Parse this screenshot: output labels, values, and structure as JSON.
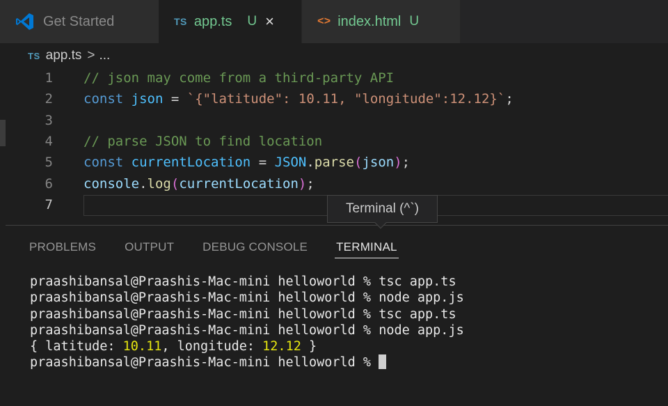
{
  "tabs": [
    {
      "label": "Get Started",
      "icon": "vscode-logo-icon",
      "active": false
    },
    {
      "label": "app.ts",
      "badge": "TS",
      "status": "U",
      "active": true
    },
    {
      "label": "index.html",
      "badge": "<>",
      "status": "U",
      "active": false
    }
  ],
  "breadcrumb": {
    "badge": "TS",
    "file": "app.ts",
    "chevron": ">",
    "more": "..."
  },
  "editor": {
    "lines": [
      {
        "num": "1",
        "tokens": [
          {
            "t": "// json may come from a third-party API",
            "c": "comment"
          }
        ]
      },
      {
        "num": "2",
        "tokens": [
          {
            "t": "const",
            "c": "kw"
          },
          {
            "t": " ",
            "c": "plain"
          },
          {
            "t": "json",
            "c": "var"
          },
          {
            "t": " = ",
            "c": "plain"
          },
          {
            "t": "`{\"latitude\": 10.11, \"longitude\":12.12}`",
            "c": "str"
          },
          {
            "t": ";",
            "c": "plain"
          }
        ]
      },
      {
        "num": "3",
        "tokens": []
      },
      {
        "num": "4",
        "tokens": [
          {
            "t": "// parse JSON to find location",
            "c": "comment"
          }
        ]
      },
      {
        "num": "5",
        "tokens": [
          {
            "t": "const",
            "c": "kw"
          },
          {
            "t": " ",
            "c": "plain"
          },
          {
            "t": "currentLocation",
            "c": "var"
          },
          {
            "t": " = ",
            "c": "plain"
          },
          {
            "t": "JSON",
            "c": "const"
          },
          {
            "t": ".",
            "c": "plain"
          },
          {
            "t": "parse",
            "c": "fn"
          },
          {
            "t": "(",
            "c": "brace"
          },
          {
            "t": "json",
            "c": "prop"
          },
          {
            "t": ")",
            "c": "brace"
          },
          {
            "t": ";",
            "c": "plain"
          }
        ]
      },
      {
        "num": "6",
        "tokens": [
          {
            "t": "console",
            "c": "prop"
          },
          {
            "t": ".",
            "c": "plain"
          },
          {
            "t": "log",
            "c": "fn"
          },
          {
            "t": "(",
            "c": "brace"
          },
          {
            "t": "currentLocation",
            "c": "prop"
          },
          {
            "t": ")",
            "c": "brace"
          },
          {
            "t": ";",
            "c": "plain"
          }
        ]
      },
      {
        "num": "7",
        "tokens": [],
        "current": true
      }
    ]
  },
  "tooltip": {
    "text": "Terminal (^`)"
  },
  "panel": {
    "tabs": [
      {
        "label": "PROBLEMS",
        "active": false
      },
      {
        "label": "OUTPUT",
        "active": false
      },
      {
        "label": "DEBUG CONSOLE",
        "active": false
      },
      {
        "label": "TERMINAL",
        "active": true
      }
    ]
  },
  "terminal": {
    "lines": [
      "praashibansal@Praashis-Mac-mini helloworld % tsc app.ts",
      "praashibansal@Praashis-Mac-mini helloworld % node app.js",
      "praashibansal@Praashis-Mac-mini helloworld % tsc app.ts",
      "praashibansal@Praashis-Mac-mini helloworld % node app.js"
    ],
    "output": {
      "open": "{ latitude: ",
      "lat": "10.11",
      "mid": ", longitude: ",
      "lon": "12.12",
      "close": " }"
    },
    "prompt": "praashibansal@Praashis-Mac-mini helloworld % "
  },
  "colors": {
    "accent_ts": "#519aba",
    "accent_html": "#e37933",
    "git_untracked": "#73c991",
    "terminal_number": "#e5e510"
  }
}
